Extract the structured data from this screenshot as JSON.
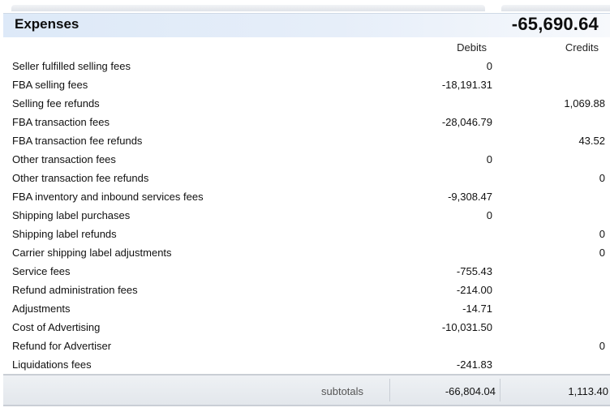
{
  "section": {
    "title": "Expenses",
    "total": "-65,690.64"
  },
  "columns": {
    "debits": "Debits",
    "credits": "Credits"
  },
  "rows": [
    {
      "label": "Seller fulfilled selling fees",
      "debit": "0",
      "credit": ""
    },
    {
      "label": "FBA selling fees",
      "debit": "-18,191.31",
      "credit": ""
    },
    {
      "label": "Selling fee refunds",
      "debit": "",
      "credit": "1,069.88"
    },
    {
      "label": "FBA transaction fees",
      "debit": "-28,046.79",
      "credit": ""
    },
    {
      "label": "FBA transaction fee refunds",
      "debit": "",
      "credit": "43.52"
    },
    {
      "label": "Other transaction fees",
      "debit": "0",
      "credit": ""
    },
    {
      "label": "Other transaction fee refunds",
      "debit": "",
      "credit": "0"
    },
    {
      "label": "FBA inventory and inbound services fees",
      "debit": "-9,308.47",
      "credit": ""
    },
    {
      "label": "Shipping label purchases",
      "debit": "0",
      "credit": ""
    },
    {
      "label": "Shipping label refunds",
      "debit": "",
      "credit": "0"
    },
    {
      "label": "Carrier shipping label adjustments",
      "debit": "",
      "credit": "0"
    },
    {
      "label": "Service fees",
      "debit": "-755.43",
      "credit": ""
    },
    {
      "label": "Refund administration fees",
      "debit": "-214.00",
      "credit": ""
    },
    {
      "label": "Adjustments",
      "debit": "-14.71",
      "credit": ""
    },
    {
      "label": "Cost of Advertising",
      "debit": "-10,031.50",
      "credit": ""
    },
    {
      "label": "Refund for Advertiser",
      "debit": "",
      "credit": "0"
    },
    {
      "label": "Liquidations fees",
      "debit": "-241.83",
      "credit": ""
    }
  ],
  "subtotals": {
    "label": "subtotals",
    "debit": "-66,804.04",
    "credit": "1,113.40"
  }
}
